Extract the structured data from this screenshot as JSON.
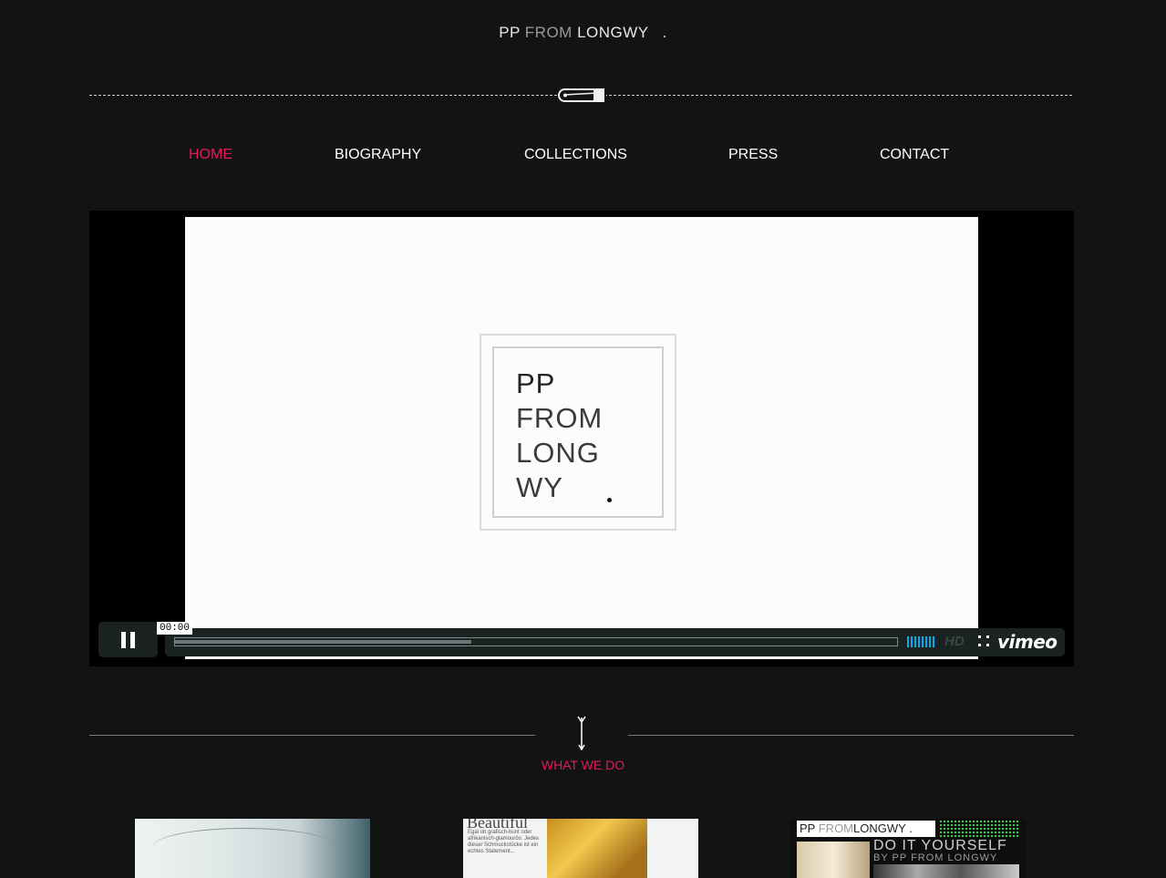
{
  "logo": {
    "pp": "PP",
    "from": "FROM",
    "longwy": "LONGWY",
    "dot": "."
  },
  "nav": {
    "items": [
      {
        "label": "HOME",
        "active": true
      },
      {
        "label": "BIOGRAPHY",
        "active": false
      },
      {
        "label": "COLLECTIONS",
        "active": false
      },
      {
        "label": "PRESS",
        "active": false
      },
      {
        "label": "CONTACT",
        "active": false
      }
    ]
  },
  "video": {
    "frame_logo": {
      "line1": "PP",
      "line2": "FROM",
      "line3": "LONG",
      "line4": "WY"
    },
    "timecode": "00:00",
    "loaded_fraction": 0.41,
    "hd_label": "HD",
    "provider_label": "vimeo"
  },
  "section": {
    "title": "WHAT WE DO"
  },
  "thumbnails": {
    "t2": {
      "heading": "Beautiful",
      "body": "Egal ob grafisch-bunt oder afrikanisch-glamourös: Jedes dieser Schmuckstücke ist ein echtes Statement..."
    },
    "t3": {
      "logo": {
        "pp": "PP",
        "from": "FROM",
        "longwy": "LONGWY",
        "dot": "."
      },
      "title": "DO IT YOURSELF",
      "subtitle": "BY PP FROM LONGWY"
    }
  },
  "colors": {
    "background": "#121414",
    "accent": "#e5195a",
    "vimeo_blue": "#00adef"
  }
}
